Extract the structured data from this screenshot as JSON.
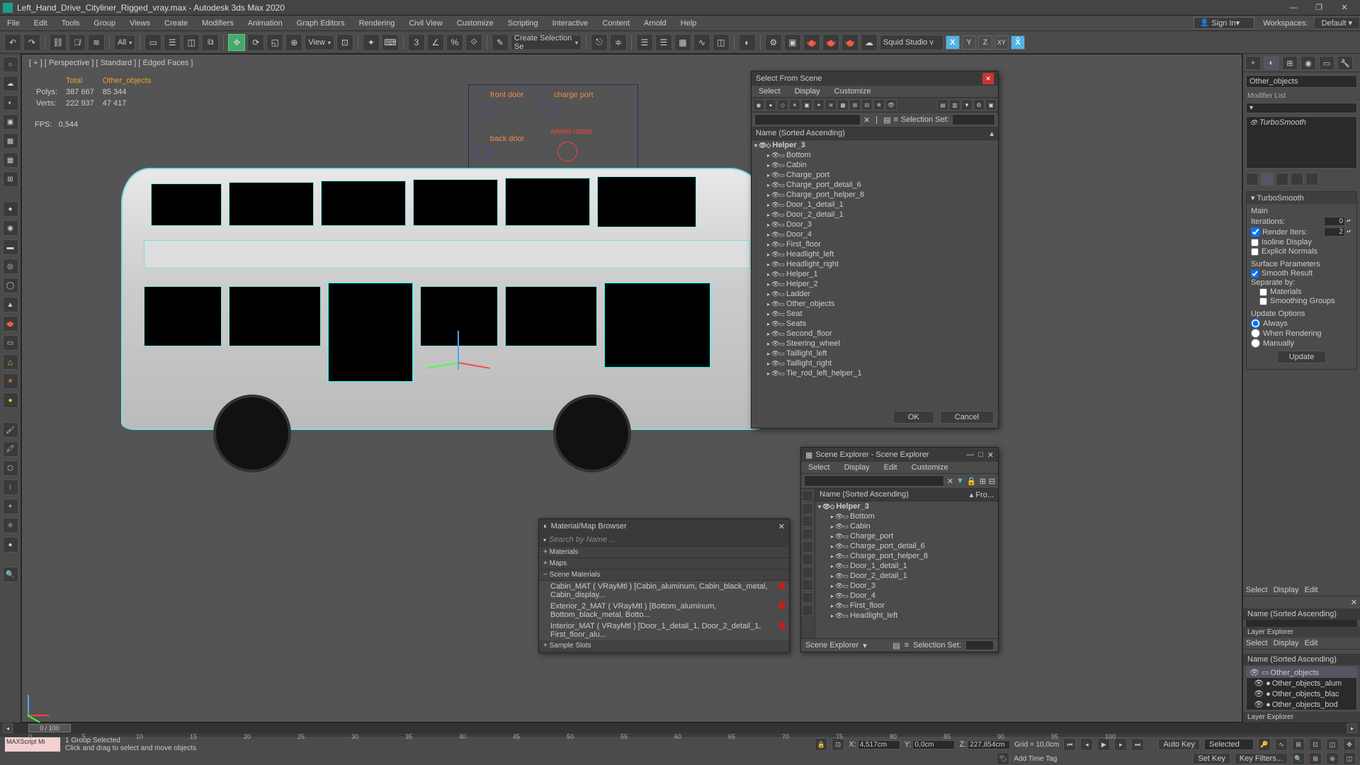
{
  "app": {
    "title": "Left_Hand_Drive_Cityliner_Rigged_vray.max - Autodesk 3ds Max 2020",
    "signin": "Sign In",
    "workspaces_label": "Workspaces:",
    "workspace": "Default"
  },
  "menu": [
    "File",
    "Edit",
    "Tools",
    "Group",
    "Views",
    "Create",
    "Modifiers",
    "Animation",
    "Graph Editors",
    "Rendering",
    "Civil View",
    "Customize",
    "Scripting",
    "Interactive",
    "Content",
    "Arnold",
    "Help"
  ],
  "toolbar": {
    "all": "All",
    "view": "View",
    "create_sel": "Create Selection Se",
    "studio": "Squid Studio v",
    "axes": [
      "X",
      "Y",
      "Z",
      "XY",
      "X̂"
    ]
  },
  "viewport": {
    "label": "[ + ] [ Perspective ] [ Standard ] [ Edged Faces ]",
    "stats": {
      "hdr_total": "Total",
      "hdr_obj": "Other_objects",
      "polys_label": "Polys:",
      "polys_total": "387 667",
      "polys_obj": "85 344",
      "verts_label": "Verts:",
      "verts_total": "222 937",
      "verts_obj": "47 417",
      "fps_label": "FPS:",
      "fps": "0,544"
    },
    "rig": {
      "front_door": "front door",
      "back_door": "back door",
      "charge_port": "charge port",
      "wheel_rotate": "wheel rotate"
    }
  },
  "select_from_scene": {
    "title": "Select From Scene",
    "tabs": [
      "Select",
      "Display",
      "Customize"
    ],
    "sel_set": "Selection Set:",
    "col": "Name (Sorted Ascending)",
    "root": "Helper_3",
    "items": [
      "Bottom",
      "Cabin",
      "Charge_port",
      "Charge_port_detail_6",
      "Charge_port_helper_8",
      "Door_1_detail_1",
      "Door_2_detail_1",
      "Door_3",
      "Door_4",
      "First_floor",
      "Headlight_left",
      "Headlight_right",
      "Helper_1",
      "Helper_2",
      "Ladder",
      "Other_objects",
      "Seat",
      "Seats",
      "Second_floor",
      "Steering_wheel",
      "Taillight_left",
      "Taillight_right",
      "Tie_rod_left_helper_1"
    ],
    "ok": "OK",
    "cancel": "Cancel"
  },
  "scene_explorer": {
    "title": "Scene Explorer - Scene Explorer",
    "tabs": [
      "Select",
      "Display",
      "Edit",
      "Customize"
    ],
    "col_name": "Name (Sorted Ascending)",
    "col_fro": "▴ Fro...",
    "root": "Helper_3",
    "items": [
      "Bottom",
      "Cabin",
      "Charge_port",
      "Charge_port_detail_6",
      "Charge_port_helper_8",
      "Door_1_detail_1",
      "Door_2_detail_1",
      "Door_3",
      "Door_4",
      "First_floor",
      "Headlight_left"
    ],
    "footer": "Scene Explorer",
    "sel_set": "Selection Set:"
  },
  "material_browser": {
    "title": "Material/Map Browser",
    "search": "Search by Name ...",
    "sec_materials": "Materials",
    "sec_maps": "Maps",
    "sec_scene": "Scene Materials",
    "sec_sample": "Sample Slots",
    "mats": [
      "Cabin_MAT ( VRayMtl ) [Cabin_aluminum, Cabin_black_metal, Cabin_display...",
      "Exterior_2_MAT ( VRayMtl ) [Bottom_aluminum, Bottom_black_metal, Botto...",
      "Interior_MAT ( VRayMtl ) [Door_1_detail_1, Door_2_detail_1, First_floor_alu..."
    ]
  },
  "command_panel": {
    "obj_name": "Other_objects",
    "mod_list_label": "Modifier List",
    "modifier": "TurboSmooth",
    "rollout": "TurboSmooth",
    "main": "Main",
    "iterations": "Iterations:",
    "iterations_v": "0",
    "render_iters": "Render Iters:",
    "render_iters_v": "2",
    "isoline": "Isoline Display",
    "explicit": "Explicit Normals",
    "surface": "Surface Parameters",
    "smooth_result": "Smooth Result",
    "separate": "Separate by:",
    "materials": "Materials",
    "smoothing_groups": "Smoothing Groups",
    "update_options": "Update Options",
    "always": "Always",
    "when_rendering": "When Rendering",
    "manually": "Manually",
    "update": "Update"
  },
  "dock": {
    "tabs": [
      "Select",
      "Display",
      "Edit"
    ],
    "name_col": "Name (Sorted Ascending)",
    "layer_explorer": "Layer Explorer",
    "items": [
      "Other_objects",
      "Other_objects_alum",
      "Other_objects_blac",
      "Other_objects_bod"
    ]
  },
  "bottom": {
    "frame": "0 / 100",
    "ticks": [
      "0",
      "5",
      "10",
      "15",
      "20",
      "25",
      "30",
      "35",
      "40",
      "45",
      "50",
      "55",
      "60",
      "65",
      "70",
      "75",
      "80",
      "85",
      "90",
      "95",
      "100"
    ],
    "script": "MAXScript Mi",
    "status1": "1 Group Selected",
    "status2": "Click and drag to select and move objects",
    "x_label": "X:",
    "x": "4,517cm",
    "y_label": "Y:",
    "y": "0,0cm",
    "z_label": "Z:",
    "z": "227,854cm",
    "grid": "Grid = 10,0cm",
    "add_time_tag": "Add Time Tag",
    "auto_key": "Auto Key",
    "set_key": "Set Key",
    "selected": "Selected",
    "key_filters": "Key Filters..."
  }
}
